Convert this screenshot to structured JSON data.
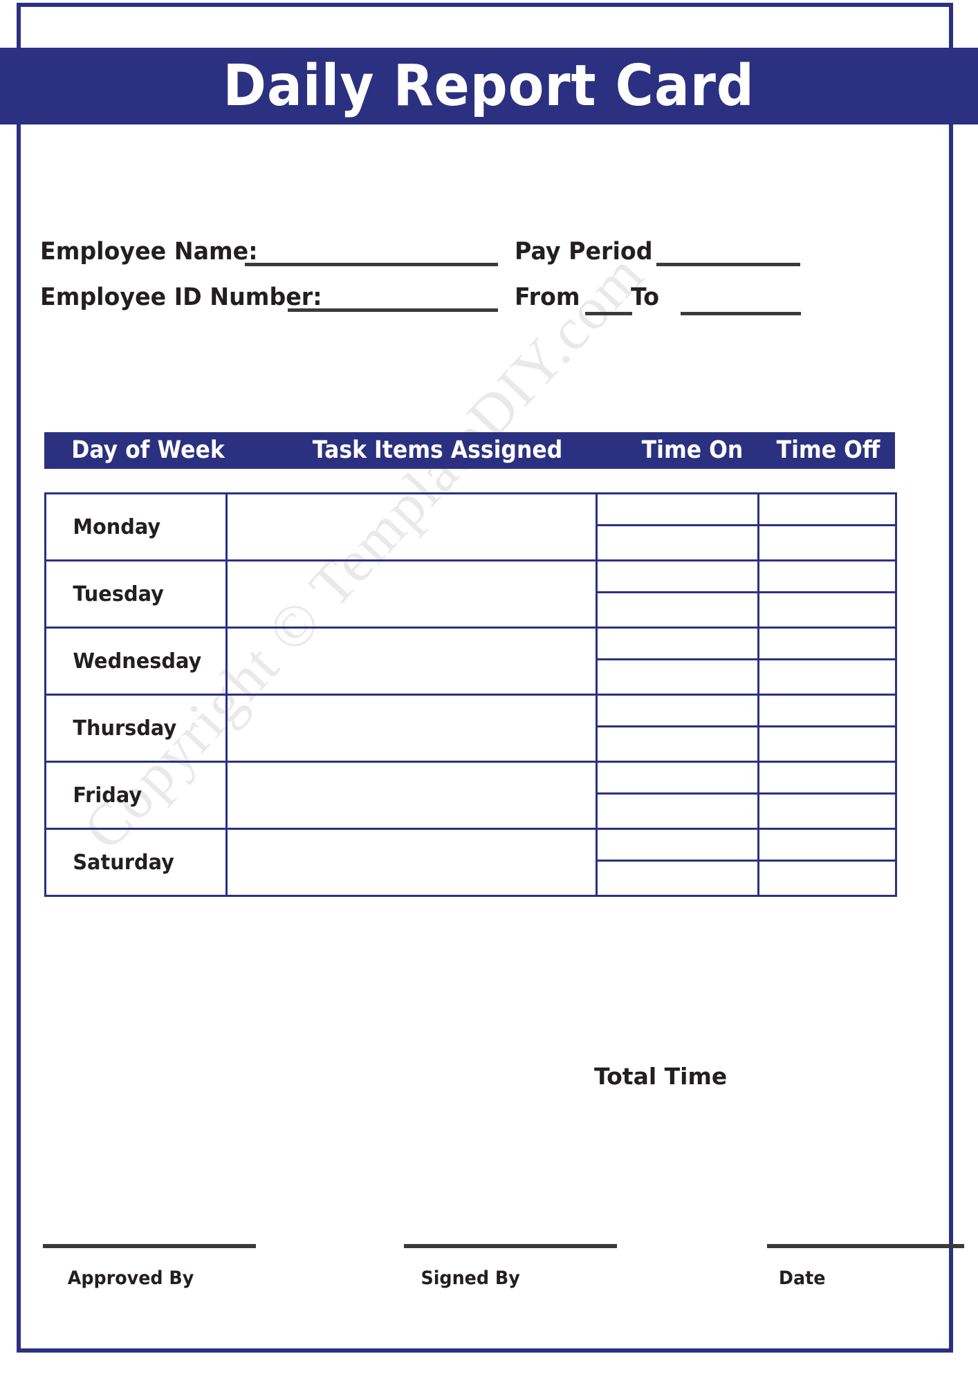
{
  "document": {
    "title": "Daily Report Card",
    "watermark": "Copyright © TemplateDIY.com"
  },
  "colors": {
    "navy": "#2b3180",
    "text": "#231f20",
    "rule": "#3a3a3a",
    "watermark": "#e9e9e9"
  },
  "employee_info": {
    "name_label": "Employee Name:",
    "id_label": "Employee ID Number:",
    "pay_period_label": "Pay Period",
    "from_label": "From",
    "to_label": "To",
    "name_value": "",
    "id_value": "",
    "pay_period_value": "",
    "from_value": "",
    "to_value": ""
  },
  "table": {
    "headers": {
      "day": "Day of Week",
      "task": "Task Items Assigned",
      "time_on": "Time On",
      "time_off": "Time Off"
    },
    "rows": [
      {
        "day": "Monday",
        "task": "",
        "time_on_1": "",
        "time_on_2": "",
        "time_off_1": "",
        "time_off_2": ""
      },
      {
        "day": "Tuesday",
        "task": "",
        "time_on_1": "",
        "time_on_2": "",
        "time_off_1": "",
        "time_off_2": ""
      },
      {
        "day": "Wednesday",
        "task": "",
        "time_on_1": "",
        "time_on_2": "",
        "time_off_1": "",
        "time_off_2": ""
      },
      {
        "day": "Thursday",
        "task": "",
        "time_on_1": "",
        "time_on_2": "",
        "time_off_1": "",
        "time_off_2": ""
      },
      {
        "day": "Friday",
        "task": "",
        "time_on_1": "",
        "time_on_2": "",
        "time_off_1": "",
        "time_off_2": ""
      },
      {
        "day": "Saturday",
        "task": "",
        "time_on_1": "",
        "time_on_2": "",
        "time_off_1": "",
        "time_off_2": ""
      }
    ]
  },
  "totals": {
    "total_time_label": "Total Time",
    "total_time_value": ""
  },
  "signatures": {
    "approved_by_label": "Approved By",
    "signed_by_label": "Signed By",
    "date_label": "Date",
    "approved_by_value": "",
    "signed_by_value": "",
    "date_value": ""
  }
}
